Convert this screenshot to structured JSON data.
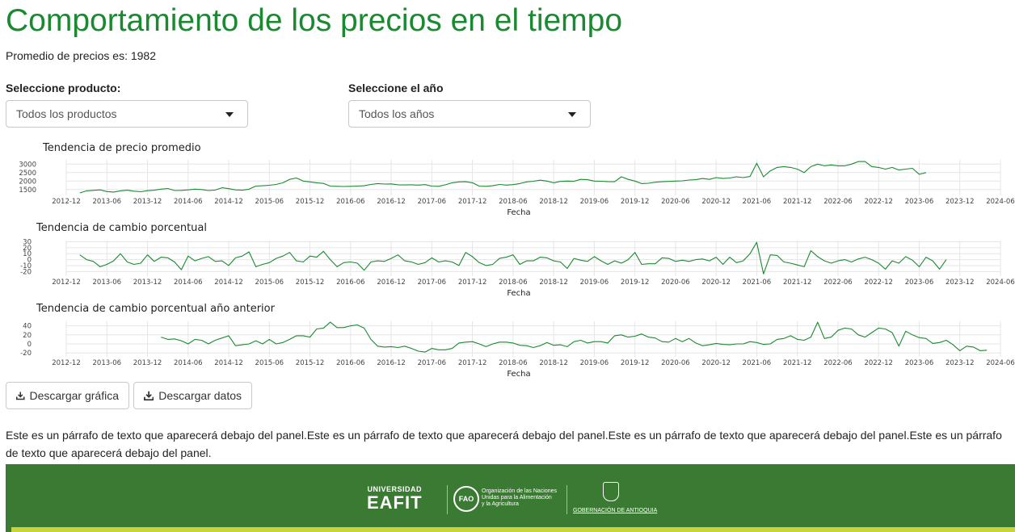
{
  "page": {
    "title": "Comportamiento de los precios en el tiempo",
    "average_text": "Promedio de precios es: 1982"
  },
  "filters": {
    "product_label": "Seleccione producto:",
    "product_value": "Todos los productos",
    "year_label": "Seleccione el año",
    "year_value": "Todos los años"
  },
  "buttons": {
    "download_chart": "Descargar gráfica",
    "download_data": "Descargar datos",
    "download_icon": "download-icon"
  },
  "paragraph": "Este es un párrafo de texto que aparecerá debajo del panel.Este es un párrafo de texto que aparecerá debajo del panel.Este es un párrafo de texto que aparecerá debajo del panel.Este es un párrafo de texto que aparecerá debajo del panel.",
  "footer": {
    "eafit_top": "UNIVERSIDAD",
    "eafit_main": "EAFIT",
    "fao_mark": "FAO",
    "fao_line1": "Organización de las Naciones",
    "fao_line2": "Unidas para la Alimentación",
    "fao_line3": "y la Agricultura",
    "antioquia": "GOBERNACIÓN DE ANTIOQUIA",
    "background_color": "#3b7a33",
    "accent_color": "#c7d43a"
  },
  "colors": {
    "title": "#1a8a30",
    "line": "#1a8a30",
    "grid": "#e6e6e6"
  },
  "chart_data": [
    {
      "type": "line",
      "title": "Tendencia de precio promedio",
      "xlabel": "Fecha",
      "ylabel": "",
      "x_ticks": [
        "2012-12",
        "2013-06",
        "2013-12",
        "2014-06",
        "2014-12",
        "2015-06",
        "2015-12",
        "2016-06",
        "2016-12",
        "2017-06",
        "2017-12",
        "2018-06",
        "2018-12",
        "2019-06",
        "2019-12",
        "2020-06",
        "2020-12",
        "2021-06",
        "2021-12",
        "2022-06",
        "2022-12",
        "2023-06",
        "2023-12",
        "2024-06"
      ],
      "y_ticks": [
        1500,
        2000,
        2500,
        3000
      ],
      "ylim": [
        1250,
        3250
      ],
      "x_start": "2013-02",
      "series": [
        {
          "values": [
            1300,
            1420,
            1450,
            1480,
            1380,
            1350,
            1420,
            1460,
            1400,
            1370,
            1430,
            1460,
            1520,
            1560,
            1440,
            1450,
            1480,
            1520,
            1500,
            1440,
            1470,
            1600,
            1550,
            1480,
            1460,
            1520,
            1700,
            1720,
            1750,
            1800,
            1900,
            2100,
            2180,
            2000,
            1950,
            1900,
            1860,
            1700,
            1690,
            1680,
            1690,
            1700,
            1720,
            1800,
            1850,
            1820,
            1830,
            1780,
            1770,
            1780,
            1760,
            1790,
            1700,
            1690,
            1780,
            1900,
            1950,
            1960,
            1900,
            1700,
            1690,
            1720,
            1800,
            1760,
            1790,
            1850,
            1950,
            1990,
            2050,
            2000,
            1900,
            1980,
            2000,
            1990,
            2100,
            2080,
            2000,
            1990,
            1970,
            1960,
            2250,
            2100,
            2000,
            1850,
            1870,
            1930,
            1960,
            1980,
            2000,
            2010,
            2060,
            2080,
            2150,
            2100,
            2200,
            2150,
            2180,
            2250,
            2200,
            2270,
            3050,
            2250,
            2600,
            2800,
            2850,
            2800,
            2700,
            2500,
            2850,
            3000,
            2900,
            2950,
            2900,
            2900,
            3000,
            3150,
            3150,
            2850,
            2800,
            2700,
            2800,
            2650,
            2700,
            2750,
            2400,
            2500
          ]
        }
      ]
    },
    {
      "type": "line",
      "title": "Tendencia de cambio porcentual",
      "xlabel": "Fecha",
      "ylabel": "",
      "x_ticks": [
        "2012-12",
        "2013-06",
        "2013-12",
        "2014-06",
        "2014-12",
        "2015-06",
        "2015-12",
        "2016-06",
        "2016-12",
        "2017-06",
        "2017-12",
        "2018-06",
        "2018-12",
        "2019-06",
        "2019-12",
        "2020-06",
        "2020-12",
        "2021-06",
        "2021-12",
        "2022-06",
        "2022-12",
        "2023-06",
        "2023-12",
        "2024-06"
      ],
      "y_ticks": [
        -20,
        -10,
        0,
        10,
        20,
        30
      ],
      "ylim": [
        -25,
        32
      ],
      "x_start": "2013-02",
      "series": [
        {
          "values": [
            8,
            0,
            -3,
            -12,
            -8,
            -2,
            10,
            -4,
            -8,
            -6,
            8,
            -3,
            4,
            3,
            -4,
            -17,
            6,
            -2,
            2,
            5,
            -3,
            -2,
            -10,
            3,
            6,
            13,
            -12,
            -8,
            -5,
            2,
            6,
            12,
            -2,
            -4,
            6,
            4,
            14,
            0,
            -12,
            -5,
            -4,
            -6,
            -18,
            -4,
            -2,
            -3,
            2,
            8,
            -2,
            -4,
            -8,
            -5,
            3,
            -4,
            -2,
            -4,
            -10,
            12,
            5,
            -5,
            -10,
            -8,
            2,
            4,
            8,
            -8,
            -2,
            -2,
            4,
            3,
            -2,
            -4,
            -15,
            2,
            -1,
            -3,
            5,
            -2,
            -8,
            -2,
            -6,
            0,
            12,
            -8,
            -7,
            -7,
            3,
            2,
            -3,
            -1,
            -3,
            0,
            1,
            -2,
            4,
            -8,
            4,
            -5,
            -2,
            10,
            29,
            -24,
            8,
            7,
            -4,
            -6,
            -9,
            -12,
            15,
            5,
            -2,
            -6,
            -2,
            0,
            -4,
            1,
            4,
            0,
            -6,
            -16,
            -2,
            -6,
            5,
            -1,
            -12,
            4,
            -2,
            -16,
            0
          ]
        }
      ]
    },
    {
      "type": "line",
      "title": "Tendencia de cambio porcentual año anterior",
      "xlabel": "Fecha",
      "ylabel": "",
      "x_ticks": [
        "2012-12",
        "2013-06",
        "2013-12",
        "2014-06",
        "2014-12",
        "2015-06",
        "2015-12",
        "2016-06",
        "2016-12",
        "2017-06",
        "2017-12",
        "2018-06",
        "2018-12",
        "2019-06",
        "2019-12",
        "2020-06",
        "2020-12",
        "2021-06",
        "2021-12",
        "2022-06",
        "2022-12",
        "2023-06",
        "2023-12",
        "2024-06"
      ],
      "y_ticks": [
        -20,
        0,
        20,
        40
      ],
      "ylim": [
        -25,
        50
      ],
      "x_start": "2014-02",
      "series": [
        {
          "values": [
            15,
            10,
            11,
            7,
            0,
            10,
            8,
            0,
            8,
            13,
            18,
            -4,
            -2,
            0,
            7,
            0,
            10,
            0,
            3,
            10,
            18,
            18,
            15,
            33,
            35,
            48,
            36,
            36,
            40,
            42,
            35,
            10,
            -5,
            -7,
            -6,
            -8,
            -5,
            -10,
            -16,
            -18,
            -10,
            -13,
            -13,
            -10,
            2,
            4,
            5,
            0,
            -6,
            0,
            4,
            4,
            2,
            -3,
            -4,
            -8,
            -4,
            3,
            -3,
            -2,
            -6,
            5,
            8,
            2,
            5,
            5,
            2,
            18,
            20,
            15,
            17,
            22,
            15,
            13,
            5,
            4,
            12,
            5,
            12,
            2,
            -4,
            -2,
            1,
            -1,
            -2,
            0,
            0,
            5,
            3,
            -1,
            0,
            10,
            12,
            18,
            10,
            8,
            15,
            48,
            12,
            15,
            30,
            35,
            33,
            20,
            15,
            25,
            35,
            33,
            25,
            -5,
            28,
            20,
            14,
            12,
            1,
            3,
            8,
            -2,
            -15,
            -5,
            -7,
            -15,
            -14
          ]
        }
      ]
    }
  ]
}
